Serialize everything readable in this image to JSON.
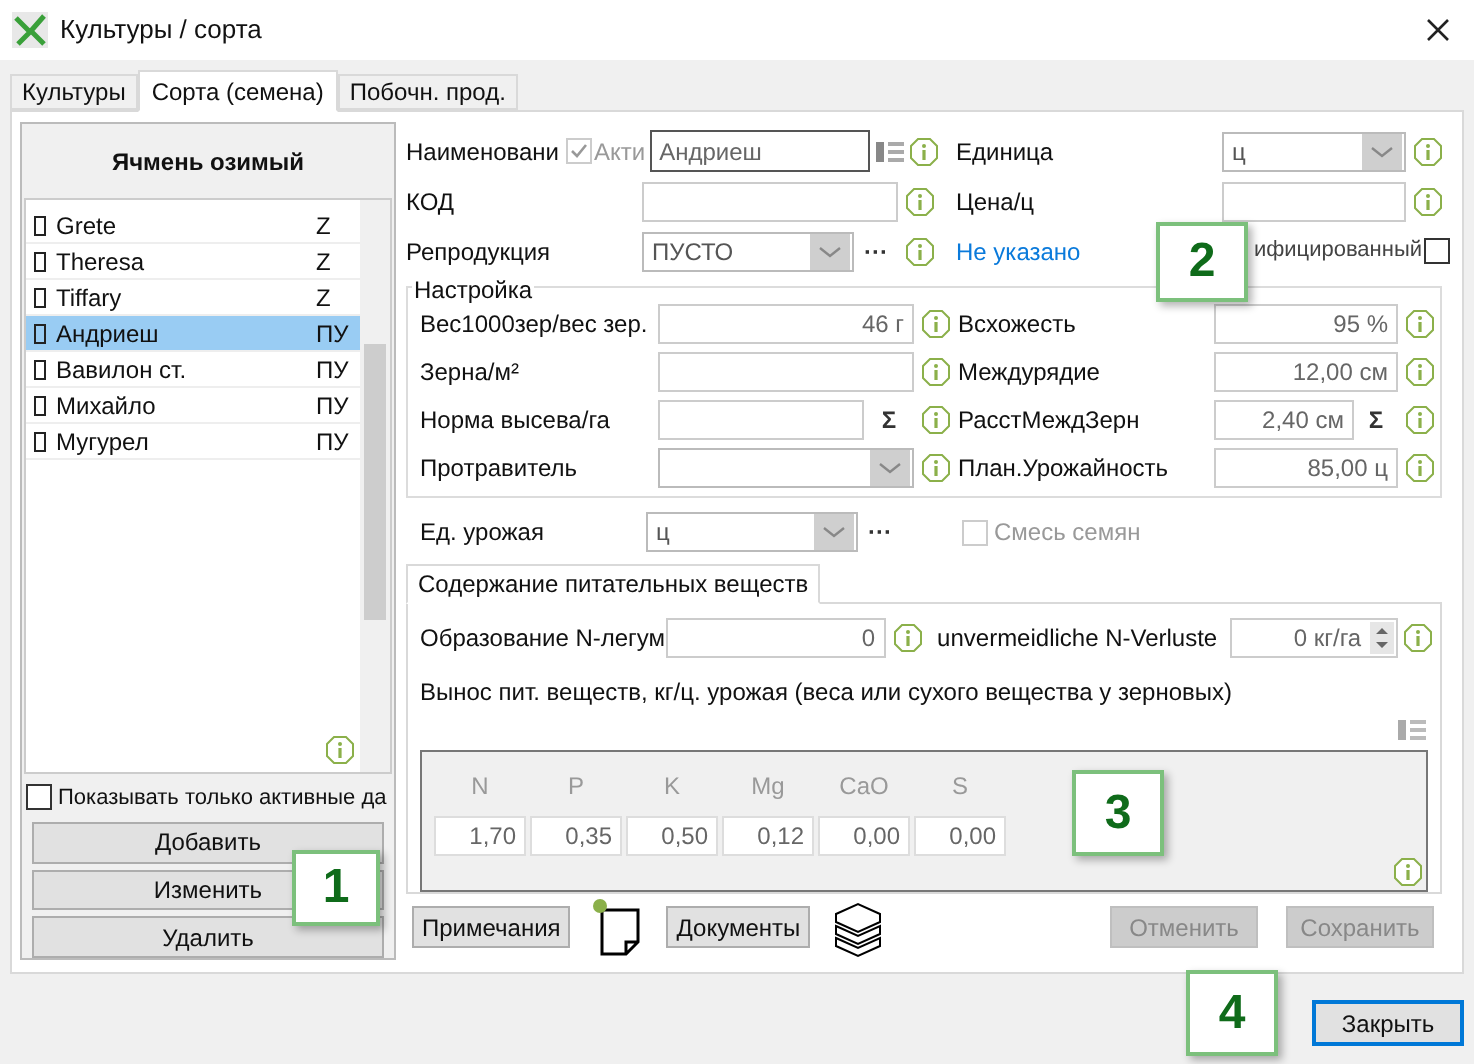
{
  "window": {
    "title": "Культуры / сорта"
  },
  "tabs": [
    {
      "label": "Культуры",
      "selected": false
    },
    {
      "label": "Сорта (семена)",
      "selected": true
    },
    {
      "label": "Побочн. прод.",
      "selected": false
    }
  ],
  "crop": "Ячмень озимый",
  "varieties": [
    {
      "name": "Grete",
      "code": "Z",
      "selected": false
    },
    {
      "name": "Theresa",
      "code": "Z",
      "selected": false
    },
    {
      "name": "Tiffary",
      "code": "Z",
      "selected": false
    },
    {
      "name": "Андриеш",
      "code": "ПУ",
      "selected": true
    },
    {
      "name": "Вавилон ст.",
      "code": "ПУ",
      "selected": false
    },
    {
      "name": "Михайло",
      "code": "ПУ",
      "selected": false
    },
    {
      "name": "Мугурел",
      "code": "ПУ",
      "selected": false
    }
  ],
  "show_active": {
    "label": "Показывать только активные да",
    "checked": false
  },
  "list_buttons": [
    "Добавить",
    "Изменить",
    "Удалить"
  ],
  "name_row": {
    "label": "Наименовани",
    "active": {
      "label": "Акти",
      "checked": true
    },
    "value": "Андриеш"
  },
  "top_fields": [
    {
      "label": "Единица",
      "value": "ц",
      "kind": "combo"
    },
    {
      "label": "КОД",
      "kind": "text"
    },
    {
      "label": "Цена/ц",
      "kind": "text"
    },
    {
      "label": "Репродукция",
      "value": "ПУСТО",
      "kind": "combo",
      "button": "···"
    }
  ],
  "link": "Не указано",
  "modified": {
    "label": "ифицированный",
    "checked": false
  },
  "settings": {
    "title": "Настройка",
    "rows": [
      [
        {
          "label": "Вес1000зер/вес зер.",
          "value": "46 г",
          "kind": "text"
        },
        {
          "label": "Всхожесть",
          "value": "95 %",
          "kind": "text"
        }
      ],
      [
        {
          "label": "Зерна/м²",
          "kind": "text"
        },
        {
          "label": "Междурядие",
          "value": "12,00 см",
          "kind": "text"
        }
      ],
      [
        {
          "label": "Норма высева/га",
          "kind": "text",
          "button": "Σ"
        },
        {
          "label": "РасстМеждЗерн",
          "value": "2,40 см",
          "kind": "text",
          "button": "Σ"
        }
      ],
      [
        {
          "label": "Протравитель",
          "kind": "combo"
        },
        {
          "label": "План.Урожайность",
          "value": "85,00 ц",
          "kind": "text"
        }
      ]
    ]
  },
  "yield_unit": {
    "label": "Ед. урожая",
    "value": "ц",
    "kind": "combo",
    "button": "···"
  },
  "seed_mix": {
    "label": "Смесь семян",
    "checked": false
  },
  "nutrient_tab": {
    "label": "Содержание питательных веществ",
    "selected": true
  },
  "n_legume": {
    "label": "Образование N-легум",
    "value": "0"
  },
  "n_losses": {
    "label": "unvermeidliche N-Verluste",
    "value": "0 кг/га"
  },
  "removal_label": "Вынос пит. веществ, кг/ц. урожая (веса или сухого вещества у зерновых)",
  "nutrients": [
    {
      "name": "N",
      "value": "1,70"
    },
    {
      "name": "P",
      "value": "0,35"
    },
    {
      "name": "K",
      "value": "0,50"
    },
    {
      "name": "Mg",
      "value": "0,12"
    },
    {
      "name": "CaO",
      "value": "0,00"
    },
    {
      "name": "S",
      "value": "0,00"
    }
  ],
  "bottom_buttons": [
    {
      "label": "Примечания",
      "disabled": false,
      "kind": "notes"
    },
    {
      "label": "Документы",
      "disabled": false,
      "kind": "docs"
    },
    {
      "label": "Отменить",
      "disabled": true
    },
    {
      "label": "Сохранить",
      "disabled": true
    }
  ],
  "close_button": "Закрыть",
  "callouts": [
    "1",
    "2",
    "3",
    "4"
  ]
}
